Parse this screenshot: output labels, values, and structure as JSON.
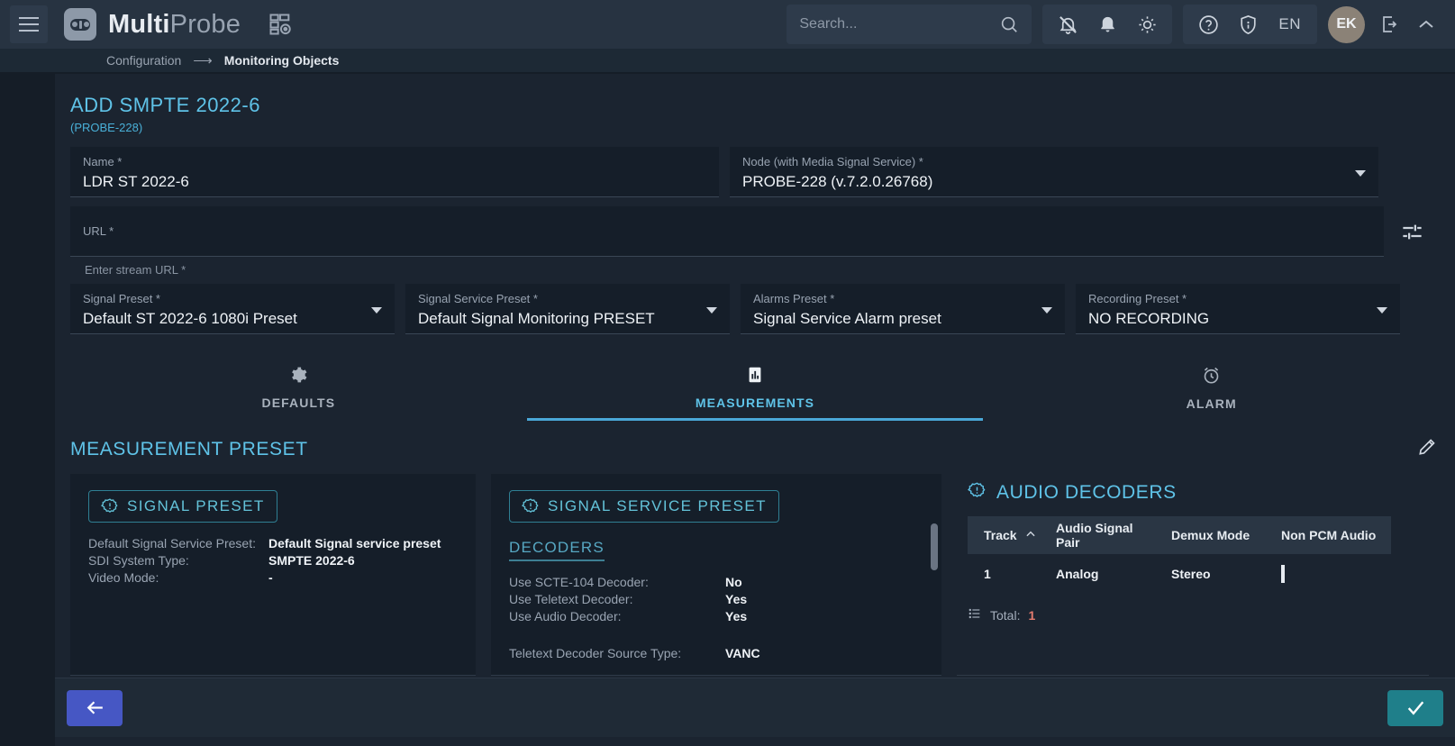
{
  "header": {
    "logo_bold": "Multi",
    "logo_light": "Probe",
    "menu_icon": "hamburger-icon",
    "grid_icon": "dashboard-grid-icon",
    "search_placeholder": "Search...",
    "language": "EN",
    "avatar_initials": "EK"
  },
  "breadcrumb": {
    "parent": "Configuration",
    "arrow": "⟶",
    "current": "Monitoring Objects"
  },
  "page": {
    "title": "ADD SMPTE 2022-6",
    "subtitle": "(PROBE-228)"
  },
  "form": {
    "name": {
      "label": "Name *",
      "value": "LDR ST 2022-6"
    },
    "node": {
      "label": "Node (with Media Signal Service) *",
      "value": "PROBE-228 (v.7.2.0.26768)"
    },
    "url": {
      "label": "URL *",
      "value": "",
      "hint": "Enter stream URL *"
    },
    "signal_preset": {
      "label": "Signal Preset *",
      "value": "Default ST 2022-6 1080i Preset"
    },
    "signal_service_preset": {
      "label": "Signal Service Preset *",
      "value": "Default Signal Monitoring PRESET"
    },
    "alarms_preset": {
      "label": "Alarms Preset *",
      "value": "Signal Service Alarm preset"
    },
    "recording_preset": {
      "label": "Recording Preset *",
      "value": "NO RECORDING"
    }
  },
  "tabs": [
    {
      "label": "DEFAULTS",
      "icon": "gear-icon",
      "active": false
    },
    {
      "label": "MEASUREMENTS",
      "icon": "bar-chart-icon",
      "active": true
    },
    {
      "label": "ALARM",
      "icon": "alarm-clock-icon",
      "active": false
    }
  ],
  "measurement_preset": {
    "title": "MEASUREMENT PRESET",
    "edit_icon": "pencil-edit-icon"
  },
  "signal_preset_panel": {
    "badge": "SIGNAL PRESET",
    "badge_icon": "info-burst-icon",
    "rows": [
      {
        "key": "Default Signal Service Preset:",
        "value": "Default Signal service preset"
      },
      {
        "key": "SDI System Type:",
        "value": "SMPTE 2022-6"
      },
      {
        "key": "Video Mode:",
        "value": "-"
      }
    ]
  },
  "signal_service_preset_panel": {
    "badge": "SIGNAL SERVICE PRESET",
    "badge_icon": "info-burst-icon",
    "section": "DECODERS",
    "rows": [
      {
        "key": "Use SCTE-104 Decoder:",
        "value": "No"
      },
      {
        "key": "Use Teletext Decoder:",
        "value": "Yes"
      },
      {
        "key": "Use Audio Decoder:",
        "value": "Yes"
      }
    ],
    "rows2": [
      {
        "key": "Teletext Decoder Source Type:",
        "value": "VANC"
      }
    ]
  },
  "audio_decoders": {
    "title": "AUDIO DECODERS",
    "title_icon": "info-burst-icon",
    "columns": [
      "Track",
      "Audio Signal Pair",
      "Demux Mode",
      "Non PCM Audio"
    ],
    "sort_column": "Track",
    "sort_direction": "asc",
    "rows": [
      {
        "track": "1",
        "audio_signal_pair": "Analog",
        "demux_mode": "Stereo",
        "non_pcm_audio": false
      }
    ],
    "total_label": "Total:",
    "total_value": "1"
  },
  "footer": {
    "back_icon": "arrow-left-icon",
    "confirm_icon": "check-icon"
  },
  "colors": {
    "accent": "#5fc3e8",
    "badge_border": "#2f7f93",
    "back_button": "#4657c4",
    "confirm_button": "#1f7f8a",
    "total_number": "#e37b6e",
    "page_bg": "#1b2430",
    "field_bg": "#151e29"
  }
}
